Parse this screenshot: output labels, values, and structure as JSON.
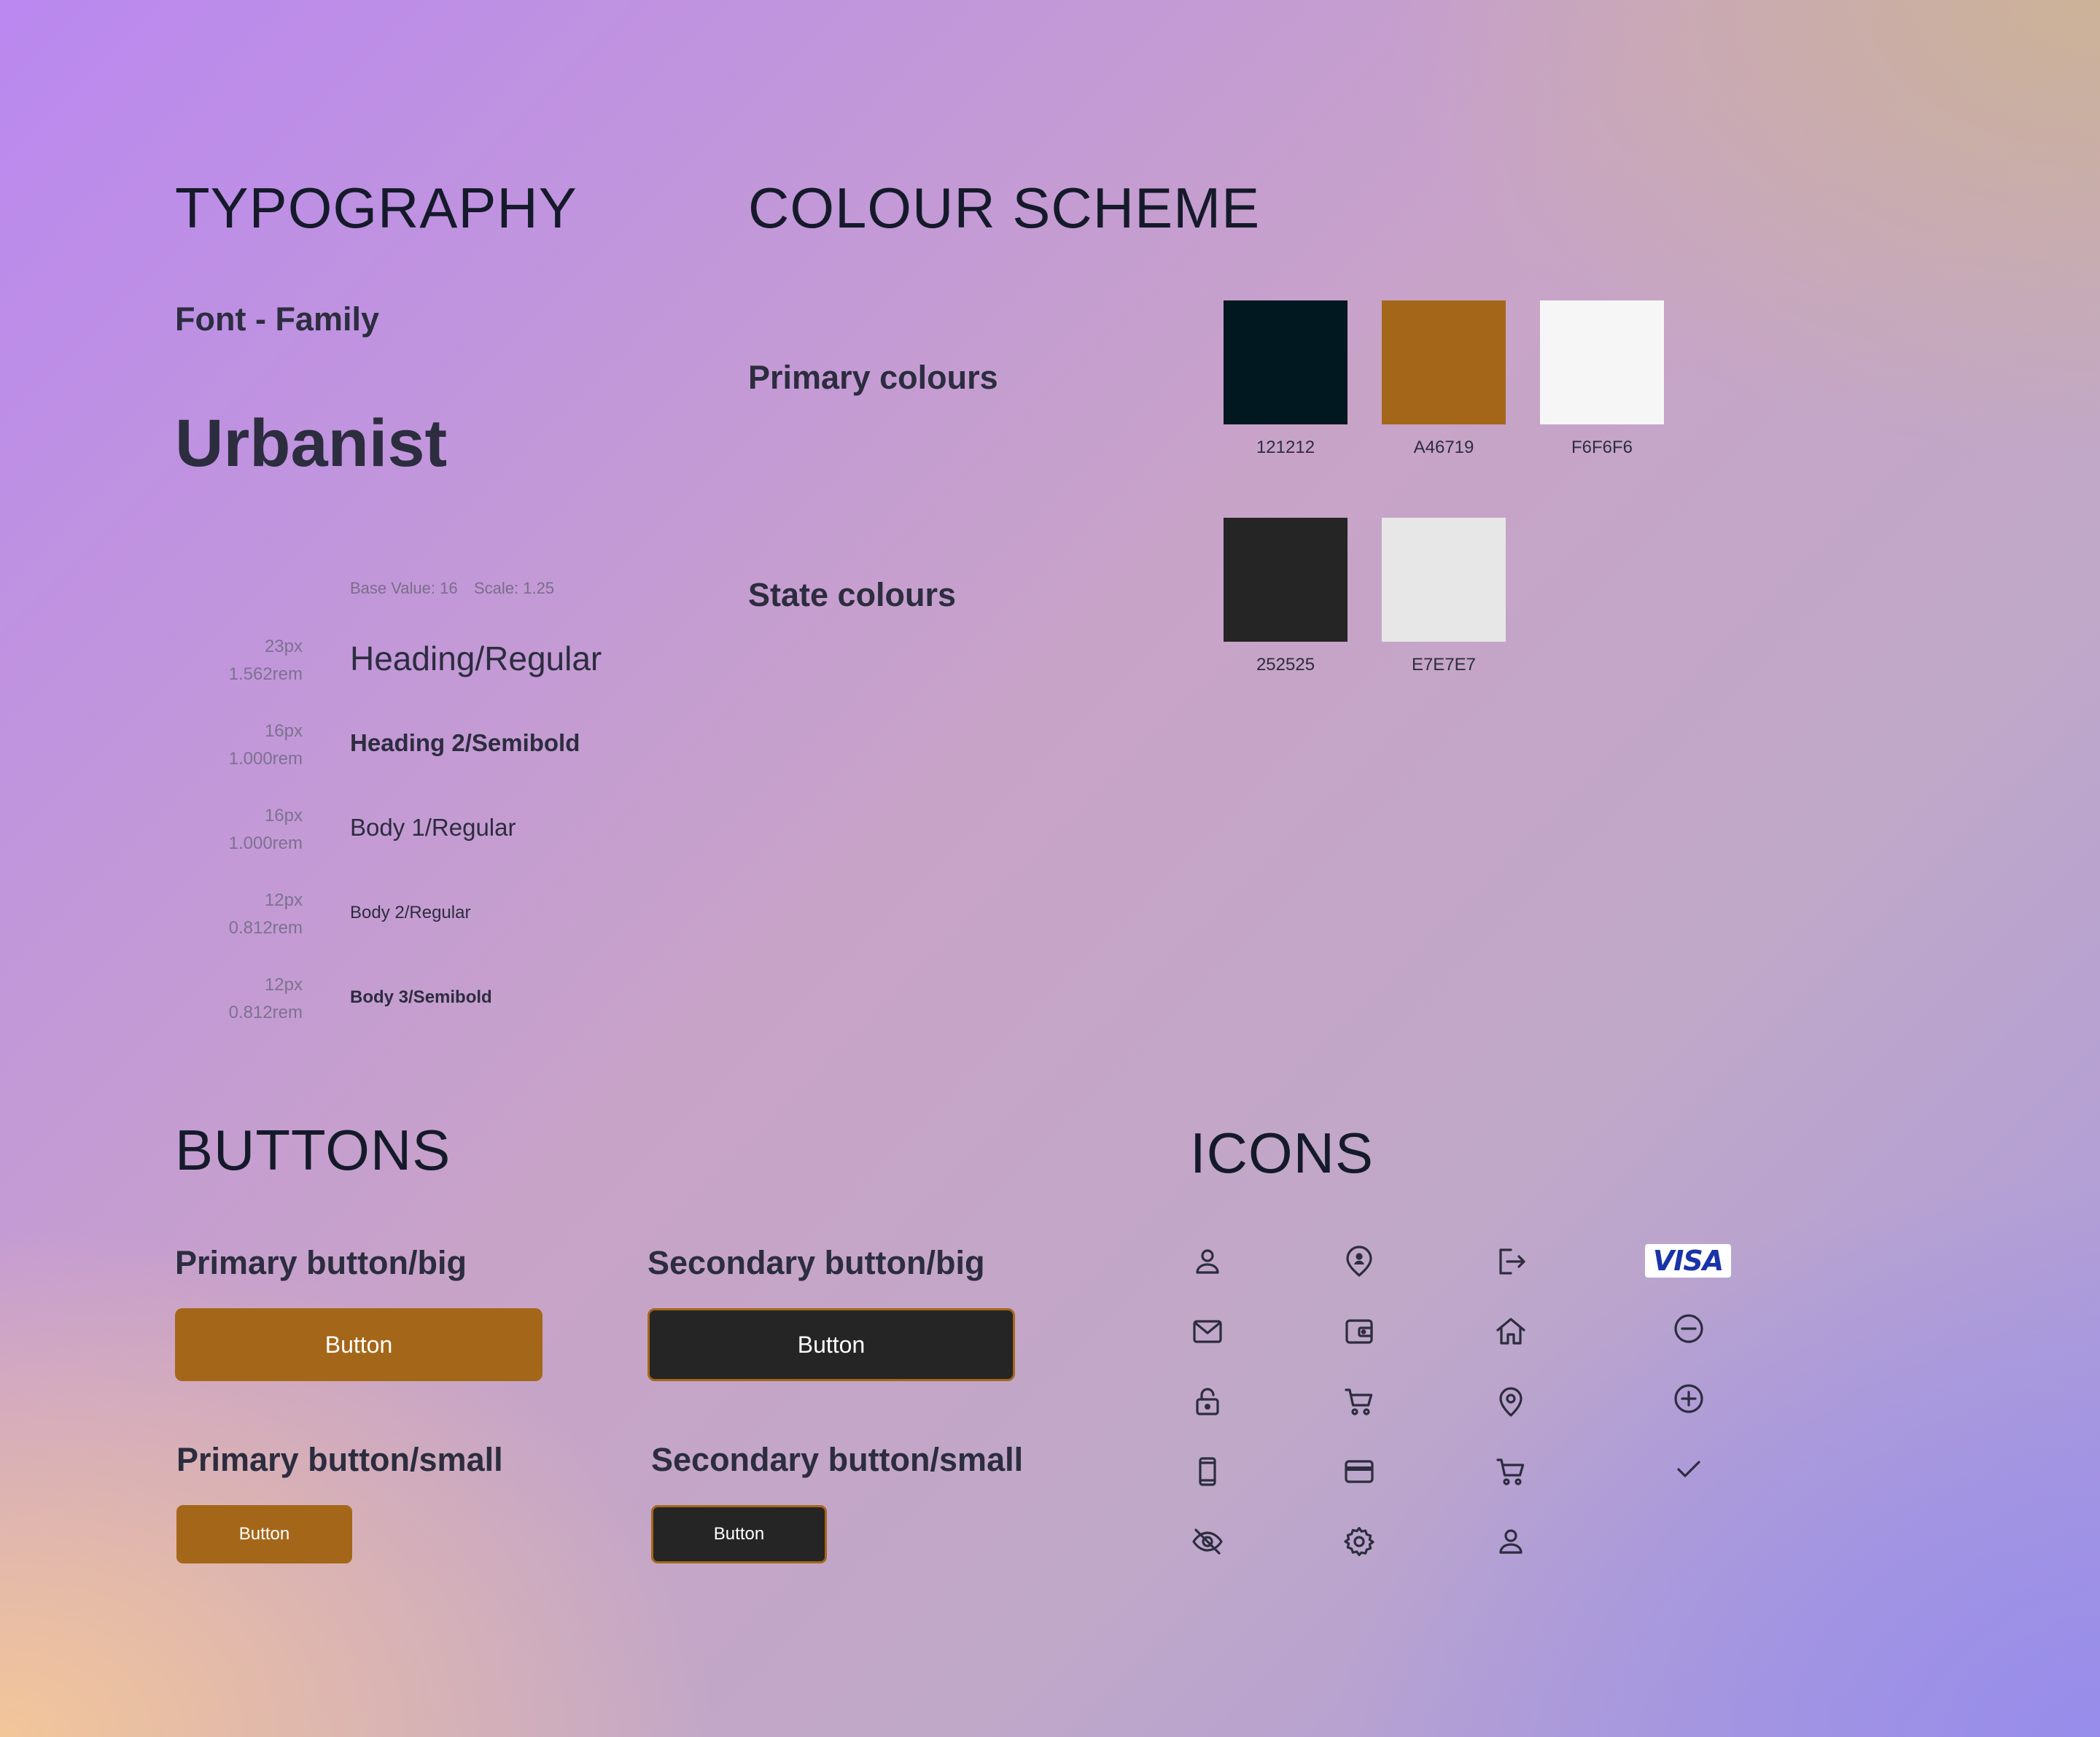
{
  "typography": {
    "title": "TYPOGRAPHY",
    "font_family_label": "Font - Family",
    "font_name": "Urbanist",
    "base_value": "Base Value: 16",
    "scale": "Scale: 1.25",
    "styles": [
      {
        "px": "23px",
        "rem": "1.562rem",
        "name": "Heading/Regular"
      },
      {
        "px": "16px",
        "rem": "1.000rem",
        "name": "Heading 2/Semibold"
      },
      {
        "px": "16px",
        "rem": "1.000rem",
        "name": "Body 1/Regular"
      },
      {
        "px": "12px",
        "rem": "0.812rem",
        "name": "Body 2/Regular"
      },
      {
        "px": "12px",
        "rem": "0.812rem",
        "name": "Body 3/Semibold"
      }
    ]
  },
  "colour_scheme": {
    "title": "COLOUR SCHEME",
    "primary_label": "Primary colours",
    "state_label": "State colours",
    "primary": [
      {
        "hex": "121212",
        "color": "#011820"
      },
      {
        "hex": "A46719",
        "color": "#a46719"
      },
      {
        "hex": "F6F6F6",
        "color": "#f6f6f6"
      }
    ],
    "state": [
      {
        "hex": "252525",
        "color": "#252525"
      },
      {
        "hex": "E7E7E7",
        "color": "#e7e7e7"
      }
    ]
  },
  "buttons": {
    "title": "BUTTONS",
    "primary_big_label": "Primary button/big",
    "secondary_big_label": "Secondary button/big",
    "primary_small_label": "Primary button/small",
    "secondary_small_label": "Secondary button/small",
    "button_text": "Button"
  },
  "icons": {
    "title": "ICONS",
    "items": [
      "user-icon",
      "user-pin-icon",
      "logout-icon",
      "visa-logo",
      "mail-icon",
      "wallet-icon",
      "home-icon",
      "minus-circle-icon",
      "lock-icon",
      "cart-icon",
      "location-pin-icon",
      "plus-circle-icon",
      "phone-icon",
      "credit-card-icon",
      "cart-icon",
      "check-icon",
      "eye-off-icon",
      "settings-icon",
      "user-icon"
    ],
    "visa_text": "VISA"
  }
}
